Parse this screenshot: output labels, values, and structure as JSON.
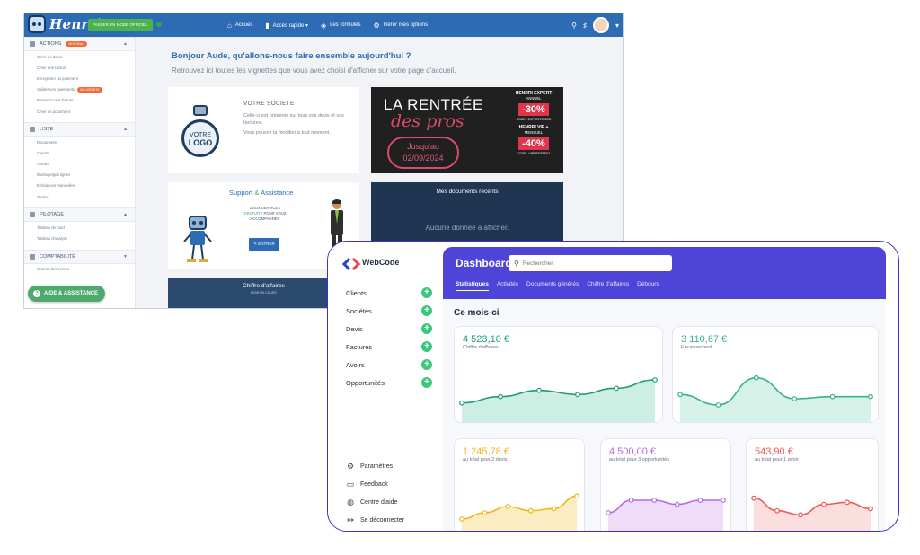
{
  "henrri": {
    "brand": "Henrri",
    "official_button": "PASSER EN MODE OFFICIEL",
    "nav": [
      {
        "icon": "home-icon",
        "glyph": "⌂",
        "label": "Accueil"
      },
      {
        "icon": "bookmark-icon",
        "glyph": "▮",
        "label": "Accès rapide ▾"
      },
      {
        "icon": "eye-icon",
        "glyph": "◈",
        "label": "Les formules"
      },
      {
        "icon": "tools-icon",
        "glyph": "⚙",
        "label": "Gérer mes options"
      }
    ],
    "sidebar": {
      "actions": {
        "label": "ACTIONS",
        "badge": "NOUVEAU",
        "items": [
          "Créer un devis",
          "Créer une facture",
          "Enregistrer un paiement",
          "Valider vos paiements",
          "Relancez une facture",
          "Créer un document"
        ],
        "validate_badge": "NOUVEAUTÉ"
      },
      "liste": {
        "label": "LISTE",
        "items": [
          "Documents",
          "Clients",
          "Articles",
          "Montage/ges lignes",
          "Échéances manuelles",
          "Toutes"
        ]
      },
      "pilotage": {
        "label": "PILOTAGE",
        "items": [
          "Tableau de bord",
          "Tableau d'analyse"
        ]
      },
      "comptabilite": {
        "label": "COMPTABILITÉ",
        "items": [
          "Journal des ventes"
        ]
      }
    },
    "aide_button": "AIDE & ASSISTANCE",
    "greeting": "Bonjour Aude, qu'allons-nous faire ensemble aujourd'hui ?",
    "subtitle": "Retrouvez ici toutes les vignettes que vous avez choisi d'afficher sur votre page d'accueil.",
    "societe": {
      "logo_line1": "VOTRE",
      "logo_line2": "LOGO",
      "title": "VOTRE SOCIETE",
      "text1": "Celle-ci est présente sur tous vos devis et vos factures.",
      "text2": "Vous pouvez la modifier à tout moment."
    },
    "promo": {
      "headline": "LA RENTRÉE",
      "script": "des pros",
      "until_line1": "Jusqu'au",
      "until_line2": "02/09/2024",
      "offer1_title": "HENRRI EXPERT",
      "offer1_period": "ANNUEL",
      "offer1_pct": "-30%",
      "offer1_code": "CODE : EXPRENTREE2",
      "offer2_title": "HENRRI VIP +",
      "offer2_period": "MENSUEL",
      "offer2_pct": "-40%",
      "offer2_code": "CODE : VIPRENTREE1"
    },
    "support": {
      "title_a": "Support",
      "title_amp": "&",
      "title_b": "Assistance",
      "line1": "DEUX SERVICES",
      "line2": "GRATUITS",
      "line2b": "POUR VOUS",
      "line3": "ACCOMPAGNER",
      "button": "ENTRER"
    },
    "docs": {
      "title": "Mes documents récents",
      "empty": "Aucune donnée à afficher."
    },
    "ca": {
      "title": "Chiffre d'affaires",
      "sub": "MOIS EN COURS"
    }
  },
  "webcode": {
    "brand": "WebCode",
    "menu": [
      "Clients",
      "Sociétés",
      "Devis",
      "Factures",
      "Avoirs",
      "Opportunités"
    ],
    "bottom": [
      {
        "icon": "gear-icon",
        "glyph": "⚙",
        "label": "Paramètres"
      },
      {
        "icon": "chat-icon",
        "glyph": "▭",
        "label": "Feedback"
      },
      {
        "icon": "globe-icon",
        "glyph": "◍",
        "label": "Centre d'aide"
      },
      {
        "icon": "logout-icon",
        "glyph": "↦",
        "label": "Se déconnecter"
      }
    ],
    "title": "Dashboard",
    "search_placeholder": "Rechercher",
    "tabs": [
      "Statistiques",
      "Activités",
      "Documents générés",
      "Chiffre d'affaires",
      "Débours"
    ],
    "section": "Ce mois-ci",
    "colors": {
      "accent": "#4e45d8",
      "green": "#3cc77d"
    }
  },
  "stats": [
    {
      "value": "4 523,10 €",
      "label": "Chiffre d'affaires",
      "color": "#1f9c7a",
      "fill": "#cdeee3",
      "values": [
        4,
        7,
        10,
        8,
        11,
        15
      ]
    },
    {
      "value": "3 110,67 €",
      "label": "Encaissement",
      "color": "#39b08f",
      "fill": "#d6f2e8",
      "values": [
        8,
        3,
        16,
        6,
        7,
        7
      ]
    },
    {
      "value": "1 245,78 €",
      "label": "au total pour 2 devis",
      "color": "#f2b51e",
      "fill": "#fcecc2",
      "values": [
        3,
        6,
        9,
        7,
        8,
        14
      ]
    },
    {
      "value": "4 500,00 €",
      "label": "au total pour 3 opportunités",
      "color": "#b56ae0",
      "fill": "#efdcf8",
      "values": [
        6,
        12,
        12,
        10,
        12,
        12
      ]
    },
    {
      "value": "543,90 €",
      "label": "au total pour 1 avoir",
      "color": "#ee5a5a",
      "fill": "#fbdede",
      "values": [
        13,
        7,
        5,
        10,
        11,
        8
      ]
    }
  ]
}
